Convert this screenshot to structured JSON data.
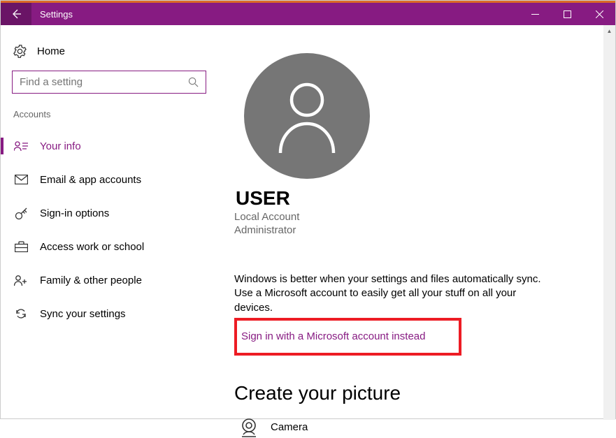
{
  "titlebar": {
    "title": "Settings"
  },
  "sidebar": {
    "home_label": "Home",
    "search_placeholder": "Find a setting",
    "section_label": "Accounts",
    "items": [
      {
        "label": "Your info"
      },
      {
        "label": "Email & app accounts"
      },
      {
        "label": "Sign-in options"
      },
      {
        "label": "Access work or school"
      },
      {
        "label": "Family & other people"
      },
      {
        "label": "Sync your settings"
      }
    ]
  },
  "main": {
    "username": "USER",
    "account_type": "Local Account",
    "account_role": "Administrator",
    "info_text": "Windows is better when your settings and files automatically sync. Use a Microsoft account to easily get all your stuff on all your devices.",
    "signin_link": "Sign in with a Microsoft account instead",
    "picture_heading": "Create your picture",
    "camera_label": "Camera"
  }
}
